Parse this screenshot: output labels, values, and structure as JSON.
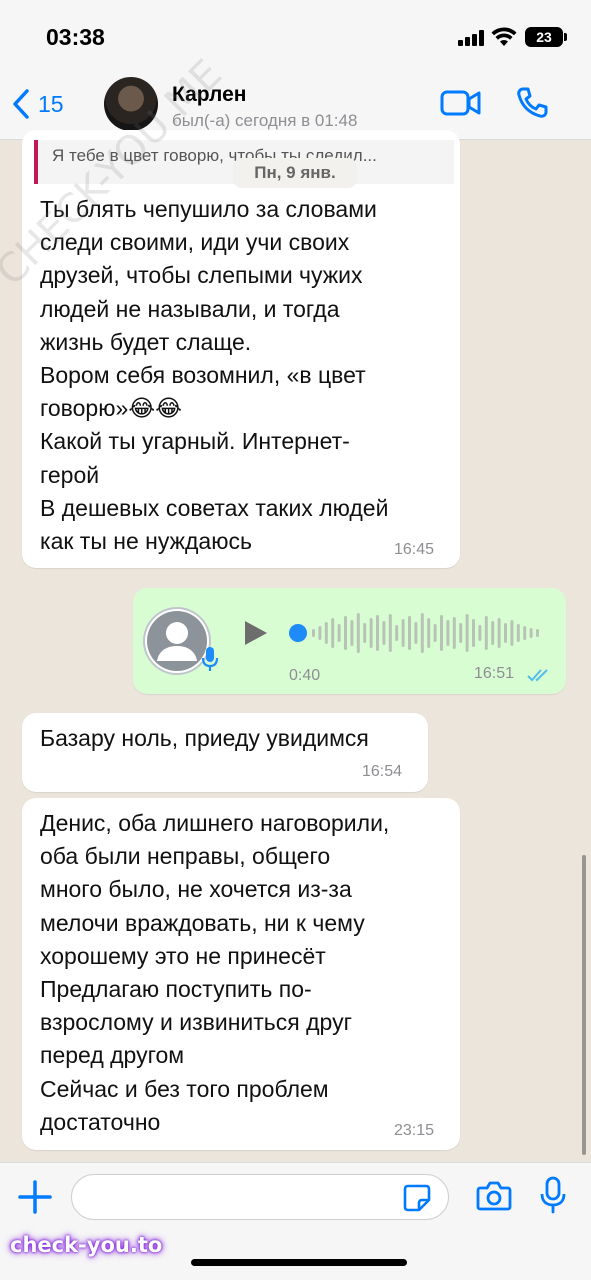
{
  "status_bar": {
    "time": "03:38",
    "battery": "23"
  },
  "header": {
    "back_count": "15",
    "contact_name": "Карлен",
    "contact_status": "был(-а) сегодня в 01:48"
  },
  "reply_preview": {
    "text": "Я тебе в цвет говорю, чтобы ты следил..."
  },
  "date_chip": "Пн, 9 янв.",
  "messages": [
    {
      "direction": "incoming",
      "text": "Ты блять чепушило за словами\nследи своими, иди учи своих\nдрузей, чтобы слепыми чужих\nлюдей не называли, и тогда\nжизнь будет слаще.\nВором себя возомнил, «в цвет\nговорю»😂😂\nКакой ты угарный. Интернет-\nгерой\nВ дешевых советах таких людей\nкак ты не нуждаюсь",
      "time": "16:45"
    },
    {
      "direction": "outgoing",
      "type": "voice",
      "duration": "0:40",
      "time": "16:51",
      "status": "read"
    },
    {
      "direction": "incoming",
      "text": "Базару ноль, приеду увидимся",
      "time": "16:54"
    },
    {
      "direction": "incoming",
      "text": "Денис, оба лишнего наговорили,\nоба были неправы, общего\nмного было, не хочется из-за\nмелочи враждовать, ни к чему\nхорошему это не принесёт\nПредлагаю поступить по-\nвзрослому и извиниться друг\nперед другом\nСейчас и без того проблем\nдостаточно",
      "time": "23:15"
    }
  ],
  "input": {
    "placeholder": ""
  },
  "watermark": {
    "badge": "check-you.to",
    "diagonal": "CHECK-YOU.ME"
  },
  "colors": {
    "accent": "#007aff",
    "outgoing_bubble": "#d9fdd3",
    "incoming_bubble": "#ffffff",
    "chat_background": "#ece5dc",
    "read_ticks": "#53bdeb",
    "reply_bar": "#c2185b"
  },
  "icons": [
    "back-chevron-icon",
    "video-call-icon",
    "phone-call-icon",
    "play-icon",
    "microphone-icon",
    "plus-icon",
    "sticker-icon",
    "camera-icon",
    "double-check-icon",
    "wifi-icon",
    "signal-icon",
    "battery-icon"
  ]
}
